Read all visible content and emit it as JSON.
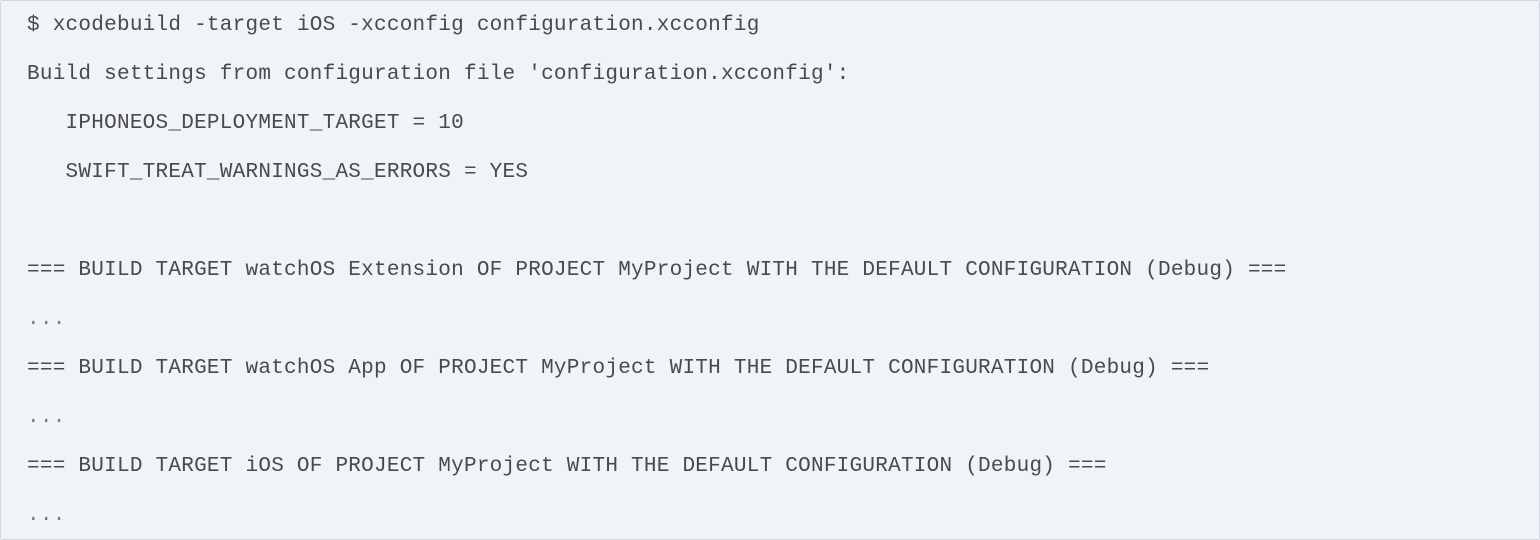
{
  "terminal": {
    "lines": [
      "$ xcodebuild -target iOS -xcconfig configuration.xcconfig",
      "Build settings from configuration file 'configuration.xcconfig':",
      "   IPHONEOS_DEPLOYMENT_TARGET = 10",
      "   SWIFT_TREAT_WARNINGS_AS_ERRORS = YES",
      "",
      "=== BUILD TARGET watchOS Extension OF PROJECT MyProject WITH THE DEFAULT CONFIGURATION (Debug) ===",
      "...",
      "=== BUILD TARGET watchOS App OF PROJECT MyProject WITH THE DEFAULT CONFIGURATION (Debug) ===",
      "...",
      "=== BUILD TARGET iOS OF PROJECT MyProject WITH THE DEFAULT CONFIGURATION (Debug) ===",
      "..."
    ]
  },
  "colors": {
    "background": "#f0f3f8",
    "border": "#d3d8e0",
    "text": "#4a4a4a"
  }
}
